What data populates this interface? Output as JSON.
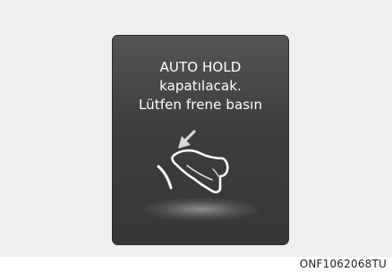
{
  "display": {
    "message_lines": [
      "AUTO HOLD",
      "kapatılacak.",
      "Lütfen frene basın"
    ],
    "icon": "foot-pressing-brake-pedal-icon"
  },
  "caption": "ONF1062068TU",
  "colors": {
    "background": "#efefef",
    "display_panel": "#3f3f3f",
    "text": "#ffffff"
  }
}
